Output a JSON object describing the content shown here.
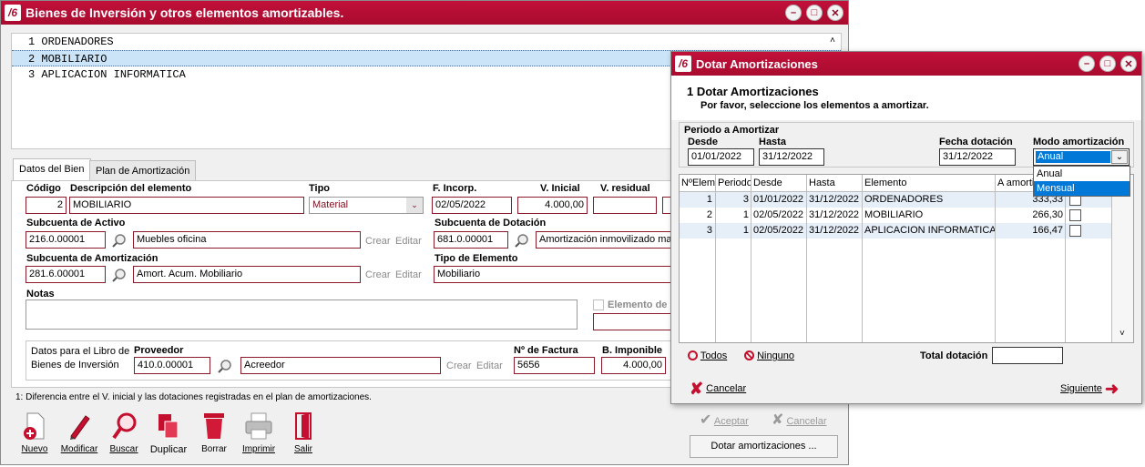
{
  "main_window": {
    "title": "Bienes de Inversión y otros elementos amortizables.",
    "list_items": [
      {
        "num": "1",
        "name": "ORDENADORES"
      },
      {
        "num": "2",
        "name": "MOBILIARIO"
      },
      {
        "num": "3",
        "name": "APLICACION INFORMATICA"
      }
    ],
    "tabs": [
      "Datos del Bien",
      "Plan de Amortización"
    ],
    "labels": {
      "codigo": "Código",
      "descripcion": "Descripción del elemento",
      "tipo": "Tipo",
      "f_incorp": "F. Incorp.",
      "v_inicial": "V. Inicial",
      "v_residual": "V. residual",
      "subcuenta_activo": "Subcuenta de Activo",
      "subcuenta_dotacion": "Subcuenta de Dotación",
      "subcuenta_amortizacion": "Subcuenta de Amortización",
      "tipo_elemento": "Tipo de Elemento",
      "notas": "Notas",
      "elemento_de": "Elemento de",
      "libro_line1": "Datos para el Libro de",
      "libro_line2": "Bienes de Inversión",
      "proveedor": "Proveedor",
      "n_factura": "Nº de Factura",
      "b_imponible": "B. Imponible",
      "crear": "Crear",
      "editar": "Editar",
      "footnote": "1: Diferencia entre el V. inicial y las dotaciones registradas en el plan de amortizaciones."
    },
    "values": {
      "codigo": "2",
      "descripcion": "MOBILIARIO",
      "tipo": "Material",
      "f_incorp": "02/05/2022",
      "v_inicial": "4.000,00",
      "v_residual": "",
      "activo_code": "216.0.00001",
      "activo_desc": "Muebles oficina",
      "dotacion_code": "681.0.00001",
      "dotacion_desc": "Amortización inmovilizado mat",
      "amort_code": "281.6.00001",
      "amort_desc": "Amort. Acum. Mobiliario",
      "tipo_elemento": "Mobiliario",
      "proveedor_code": "410.0.00001",
      "proveedor_desc": "Acreedor",
      "n_factura": "5656",
      "b_imponible": "4.000,00"
    },
    "toolbar": [
      "Nuevo",
      "Modificar",
      "Buscar",
      "Duplicar",
      "Borrar",
      "Imprimir",
      "Salir"
    ],
    "aceptar": "Aceptar",
    "cancelar": "Cancelar",
    "dotar_button": "Dotar amortizaciones ..."
  },
  "dialog": {
    "title": "Dotar Amortizaciones",
    "step_title": "1  Dotar Amortizaciones",
    "step_subtitle": "Por favor, seleccione los elementos a amortizar.",
    "periodo_label": "Periodo a Amortizar",
    "desde_label": "Desde",
    "hasta_label": "Hasta",
    "desde": "01/01/2022",
    "hasta": "31/12/2022",
    "fecha_dotacion_label": "Fecha dotación",
    "fecha_dotacion": "31/12/2022",
    "modo_label": "Modo amortización",
    "modo_selected": "Anual",
    "modo_options": [
      "Anual",
      "Mensual"
    ],
    "columns": [
      "NºElem.",
      "Periodo",
      "Desde",
      "Hasta",
      "Elemento",
      "A amortizar"
    ],
    "rows": [
      {
        "n": "1",
        "periodo": "3",
        "desde": "01/01/2022",
        "hasta": "31/12/2022",
        "elemento": "ORDENADORES",
        "importe": "333,33"
      },
      {
        "n": "2",
        "periodo": "1",
        "desde": "02/05/2022",
        "hasta": "31/12/2022",
        "elemento": "MOBILIARIO",
        "importe": "266,30"
      },
      {
        "n": "3",
        "periodo": "1",
        "desde": "02/05/2022",
        "hasta": "31/12/2022",
        "elemento": "APLICACION INFORMATICA",
        "importe": "166,47"
      }
    ],
    "todos": "Todos",
    "ninguno": "Ninguno",
    "total_label": "Total dotación",
    "total": "",
    "cancelar": "Cancelar",
    "siguiente": "Siguiente"
  }
}
